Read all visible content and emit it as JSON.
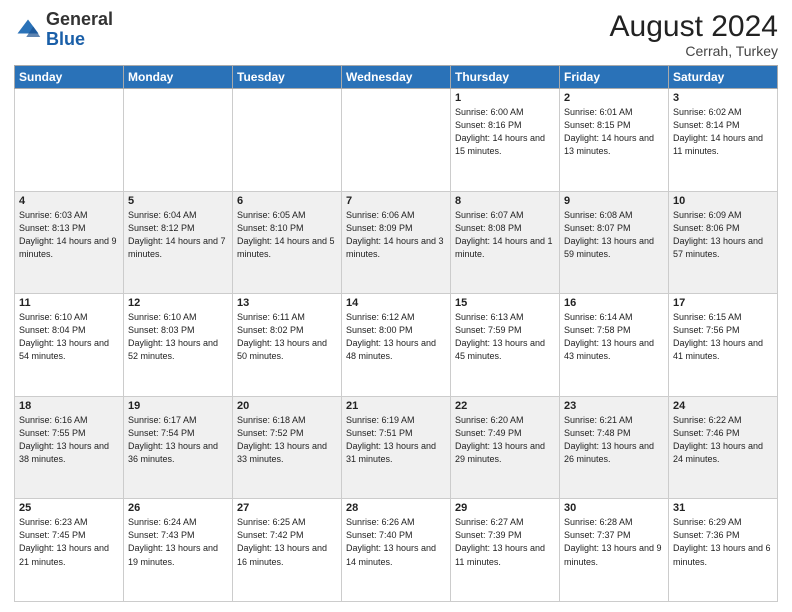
{
  "header": {
    "logo_general": "General",
    "logo_blue": "Blue",
    "month_year": "August 2024",
    "location": "Cerrah, Turkey"
  },
  "days_of_week": [
    "Sunday",
    "Monday",
    "Tuesday",
    "Wednesday",
    "Thursday",
    "Friday",
    "Saturday"
  ],
  "weeks": [
    {
      "bg": "light",
      "days": [
        {
          "num": "",
          "info": ""
        },
        {
          "num": "",
          "info": ""
        },
        {
          "num": "",
          "info": ""
        },
        {
          "num": "",
          "info": ""
        },
        {
          "num": "1",
          "info": "Sunrise: 6:00 AM\nSunset: 8:16 PM\nDaylight: 14 hours\nand 15 minutes."
        },
        {
          "num": "2",
          "info": "Sunrise: 6:01 AM\nSunset: 8:15 PM\nDaylight: 14 hours\nand 13 minutes."
        },
        {
          "num": "3",
          "info": "Sunrise: 6:02 AM\nSunset: 8:14 PM\nDaylight: 14 hours\nand 11 minutes."
        }
      ]
    },
    {
      "bg": "gray",
      "days": [
        {
          "num": "4",
          "info": "Sunrise: 6:03 AM\nSunset: 8:13 PM\nDaylight: 14 hours\nand 9 minutes."
        },
        {
          "num": "5",
          "info": "Sunrise: 6:04 AM\nSunset: 8:12 PM\nDaylight: 14 hours\nand 7 minutes."
        },
        {
          "num": "6",
          "info": "Sunrise: 6:05 AM\nSunset: 8:10 PM\nDaylight: 14 hours\nand 5 minutes."
        },
        {
          "num": "7",
          "info": "Sunrise: 6:06 AM\nSunset: 8:09 PM\nDaylight: 14 hours\nand 3 minutes."
        },
        {
          "num": "8",
          "info": "Sunrise: 6:07 AM\nSunset: 8:08 PM\nDaylight: 14 hours\nand 1 minute."
        },
        {
          "num": "9",
          "info": "Sunrise: 6:08 AM\nSunset: 8:07 PM\nDaylight: 13 hours\nand 59 minutes."
        },
        {
          "num": "10",
          "info": "Sunrise: 6:09 AM\nSunset: 8:06 PM\nDaylight: 13 hours\nand 57 minutes."
        }
      ]
    },
    {
      "bg": "light",
      "days": [
        {
          "num": "11",
          "info": "Sunrise: 6:10 AM\nSunset: 8:04 PM\nDaylight: 13 hours\nand 54 minutes."
        },
        {
          "num": "12",
          "info": "Sunrise: 6:10 AM\nSunset: 8:03 PM\nDaylight: 13 hours\nand 52 minutes."
        },
        {
          "num": "13",
          "info": "Sunrise: 6:11 AM\nSunset: 8:02 PM\nDaylight: 13 hours\nand 50 minutes."
        },
        {
          "num": "14",
          "info": "Sunrise: 6:12 AM\nSunset: 8:00 PM\nDaylight: 13 hours\nand 48 minutes."
        },
        {
          "num": "15",
          "info": "Sunrise: 6:13 AM\nSunset: 7:59 PM\nDaylight: 13 hours\nand 45 minutes."
        },
        {
          "num": "16",
          "info": "Sunrise: 6:14 AM\nSunset: 7:58 PM\nDaylight: 13 hours\nand 43 minutes."
        },
        {
          "num": "17",
          "info": "Sunrise: 6:15 AM\nSunset: 7:56 PM\nDaylight: 13 hours\nand 41 minutes."
        }
      ]
    },
    {
      "bg": "gray",
      "days": [
        {
          "num": "18",
          "info": "Sunrise: 6:16 AM\nSunset: 7:55 PM\nDaylight: 13 hours\nand 38 minutes."
        },
        {
          "num": "19",
          "info": "Sunrise: 6:17 AM\nSunset: 7:54 PM\nDaylight: 13 hours\nand 36 minutes."
        },
        {
          "num": "20",
          "info": "Sunrise: 6:18 AM\nSunset: 7:52 PM\nDaylight: 13 hours\nand 33 minutes."
        },
        {
          "num": "21",
          "info": "Sunrise: 6:19 AM\nSunset: 7:51 PM\nDaylight: 13 hours\nand 31 minutes."
        },
        {
          "num": "22",
          "info": "Sunrise: 6:20 AM\nSunset: 7:49 PM\nDaylight: 13 hours\nand 29 minutes."
        },
        {
          "num": "23",
          "info": "Sunrise: 6:21 AM\nSunset: 7:48 PM\nDaylight: 13 hours\nand 26 minutes."
        },
        {
          "num": "24",
          "info": "Sunrise: 6:22 AM\nSunset: 7:46 PM\nDaylight: 13 hours\nand 24 minutes."
        }
      ]
    },
    {
      "bg": "light",
      "days": [
        {
          "num": "25",
          "info": "Sunrise: 6:23 AM\nSunset: 7:45 PM\nDaylight: 13 hours\nand 21 minutes."
        },
        {
          "num": "26",
          "info": "Sunrise: 6:24 AM\nSunset: 7:43 PM\nDaylight: 13 hours\nand 19 minutes."
        },
        {
          "num": "27",
          "info": "Sunrise: 6:25 AM\nSunset: 7:42 PM\nDaylight: 13 hours\nand 16 minutes."
        },
        {
          "num": "28",
          "info": "Sunrise: 6:26 AM\nSunset: 7:40 PM\nDaylight: 13 hours\nand 14 minutes."
        },
        {
          "num": "29",
          "info": "Sunrise: 6:27 AM\nSunset: 7:39 PM\nDaylight: 13 hours\nand 11 minutes."
        },
        {
          "num": "30",
          "info": "Sunrise: 6:28 AM\nSunset: 7:37 PM\nDaylight: 13 hours\nand 9 minutes."
        },
        {
          "num": "31",
          "info": "Sunrise: 6:29 AM\nSunset: 7:36 PM\nDaylight: 13 hours\nand 6 minutes."
        }
      ]
    }
  ]
}
